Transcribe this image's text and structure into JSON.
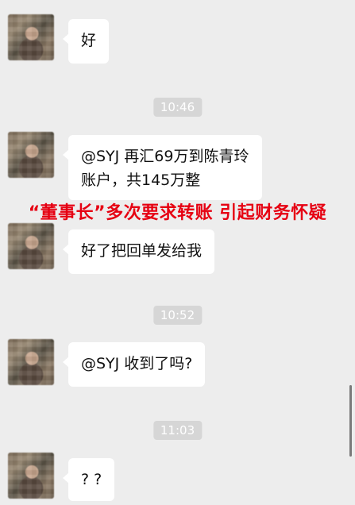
{
  "messages": [
    {
      "type": "message",
      "text": "好"
    },
    {
      "type": "timestamp",
      "text": "10:46"
    },
    {
      "type": "message",
      "text": "@SYJ 再汇69万到陈青玲\n账户，共145万整"
    },
    {
      "type": "message",
      "text": "好了把回单发给我"
    },
    {
      "type": "timestamp",
      "text": "10:52"
    },
    {
      "type": "message",
      "text": "@SYJ 收到了吗?"
    },
    {
      "type": "timestamp",
      "text": "11:03"
    },
    {
      "type": "message",
      "text": "? ?"
    }
  ],
  "overlay": {
    "caption": "“董事长”多次要求转账 引起财务怀疑",
    "color": "#e60012"
  },
  "colors": {
    "background": "#ededed",
    "bubble": "#ffffff",
    "timestamp_bg": "#d6d6d6"
  }
}
